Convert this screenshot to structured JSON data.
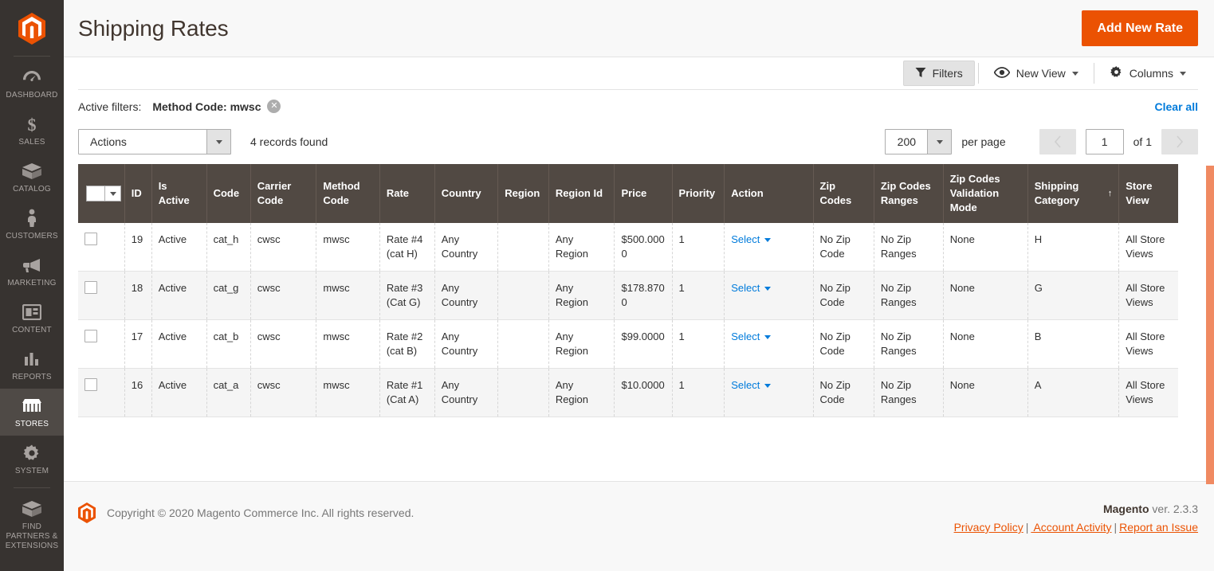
{
  "sidebar": {
    "logo_name": "magento-logo",
    "items": [
      {
        "label": "DASHBOARD",
        "icon": "dashboard-icon",
        "active": false
      },
      {
        "label": "SALES",
        "icon": "dollar-icon",
        "active": false
      },
      {
        "label": "CATALOG",
        "icon": "catalog-box-icon",
        "active": false
      },
      {
        "label": "CUSTOMERS",
        "icon": "person-icon",
        "active": false
      },
      {
        "label": "MARKETING",
        "icon": "megaphone-icon",
        "active": false
      },
      {
        "label": "CONTENT",
        "icon": "content-layout-icon",
        "active": false
      },
      {
        "label": "REPORTS",
        "icon": "bar-chart-icon",
        "active": false
      },
      {
        "label": "STORES",
        "icon": "storefront-icon",
        "active": true
      },
      {
        "label": "SYSTEM",
        "icon": "gear-icon",
        "active": false
      },
      {
        "label": "FIND PARTNERS & EXTENSIONS",
        "icon": "extensions-box-icon",
        "active": false
      }
    ]
  },
  "header": {
    "title": "Shipping Rates",
    "add_new_rate": "Add New Rate"
  },
  "toolbar": {
    "filters_label": "Filters",
    "filters_icon": "funnel-icon",
    "new_view_label": "New View",
    "new_view_icon": "eye-icon",
    "columns_label": "Columns",
    "columns_icon": "gear-icon"
  },
  "active_filters": {
    "label": "Active filters:",
    "chips": [
      {
        "text": "Method Code: mwsc"
      }
    ],
    "clear_all": "Clear all"
  },
  "controls": {
    "actions_label": "Actions",
    "records_found": "4 records found",
    "per_page_value": "200",
    "per_page_label": "per page",
    "page_value": "1",
    "of_label": "of 1",
    "prev_icon": "chevron-left-icon",
    "next_icon": "chevron-right-icon"
  },
  "grid": {
    "columns": [
      {
        "key": "checkbox",
        "label": ""
      },
      {
        "key": "id",
        "label": "ID"
      },
      {
        "key": "is_active",
        "label": "Is Active"
      },
      {
        "key": "code",
        "label": "Code"
      },
      {
        "key": "carrier_code",
        "label": "Carrier Code"
      },
      {
        "key": "method_code",
        "label": "Method Code"
      },
      {
        "key": "rate",
        "label": "Rate"
      },
      {
        "key": "country",
        "label": "Country"
      },
      {
        "key": "region",
        "label": "Region"
      },
      {
        "key": "region_id",
        "label": "Region Id"
      },
      {
        "key": "price",
        "label": "Price"
      },
      {
        "key": "priority",
        "label": "Priority"
      },
      {
        "key": "action",
        "label": "Action"
      },
      {
        "key": "zip_codes",
        "label": "Zip Codes"
      },
      {
        "key": "zip_codes_ranges",
        "label": "Zip Codes Ranges"
      },
      {
        "key": "zip_codes_validation_mode",
        "label": "Zip Codes Validation Mode"
      },
      {
        "key": "shipping_category",
        "label": "Shipping Category",
        "sorted": "asc",
        "sort_glyph": "↑"
      },
      {
        "key": "store_view",
        "label": "Store View"
      }
    ],
    "rows": [
      {
        "id": "19",
        "is_active": "Active",
        "code": "cat_h",
        "carrier_code": "cwsc",
        "method_code": "mwsc",
        "rate": "Rate #4 (cat H)",
        "country": "Any Country",
        "region": "",
        "region_id": "Any Region",
        "price": "$500.0000",
        "priority": "1",
        "action": "Select",
        "zip_codes": "No Zip Code",
        "zip_codes_ranges": "No Zip Ranges",
        "zip_codes_validation_mode": "None",
        "shipping_category": "H",
        "store_view": "All Store Views"
      },
      {
        "id": "18",
        "is_active": "Active",
        "code": "cat_g",
        "carrier_code": "cwsc",
        "method_code": "mwsc",
        "rate": "Rate #3 (Cat G)",
        "country": "Any Country",
        "region": "",
        "region_id": "Any Region",
        "price": "$178.8700",
        "priority": "1",
        "action": "Select",
        "zip_codes": "No Zip Code",
        "zip_codes_ranges": "No Zip Ranges",
        "zip_codes_validation_mode": "None",
        "shipping_category": "G",
        "store_view": "All Store Views"
      },
      {
        "id": "17",
        "is_active": "Active",
        "code": "cat_b",
        "carrier_code": "cwsc",
        "method_code": "mwsc",
        "rate": "Rate #2 (cat B)",
        "country": "Any Country",
        "region": "",
        "region_id": "Any Region",
        "price": "$99.0000",
        "priority": "1",
        "action": "Select",
        "zip_codes": "No Zip Code",
        "zip_codes_ranges": "No Zip Ranges",
        "zip_codes_validation_mode": "None",
        "shipping_category": "B",
        "store_view": "All Store Views"
      },
      {
        "id": "16",
        "is_active": "Active",
        "code": "cat_a",
        "carrier_code": "cwsc",
        "method_code": "mwsc",
        "rate": "Rate #1 (Cat A)",
        "country": "Any Country",
        "region": "",
        "region_id": "Any Region",
        "price": "$10.0000",
        "priority": "1",
        "action": "Select",
        "zip_codes": "No Zip Code",
        "zip_codes_ranges": "No Zip Ranges",
        "zip_codes_validation_mode": "None",
        "shipping_category": "A",
        "store_view": "All Store Views"
      }
    ]
  },
  "footer": {
    "copyright": "Copyright © 2020 Magento Commerce Inc. All rights reserved.",
    "version_brand": "Magento",
    "version_text": " ver. 2.3.3",
    "links": [
      "Privacy Policy",
      " Account Activity",
      "Report an Issue"
    ],
    "link_separator": "|"
  },
  "colors": {
    "brand_orange": "#eb5202",
    "sidebar_bg": "#373330",
    "table_header_bg": "#514943",
    "link_blue": "#007bdb",
    "scrollbar": "#f08a62"
  }
}
